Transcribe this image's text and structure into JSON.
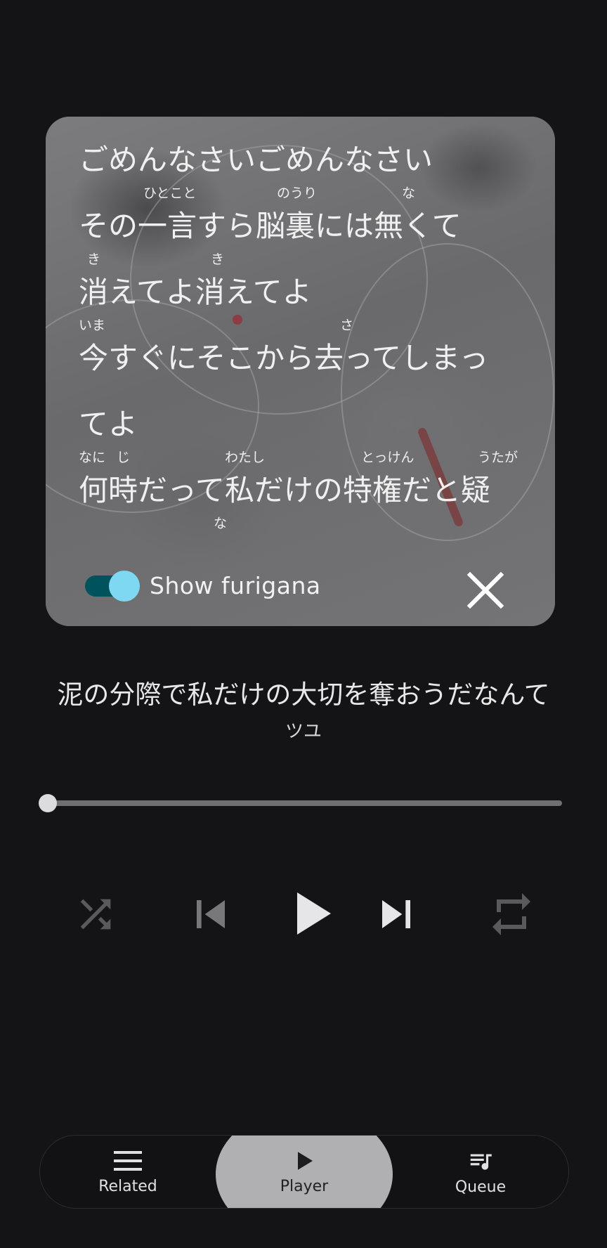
{
  "lyrics_card": {
    "lines": [
      {
        "text": "ごめんなさいごめんなさい",
        "ruby": []
      },
      {
        "text": "その一言すら脳裏には無くて",
        "ruby": [
          "ひとこと",
          "のうり",
          "な"
        ]
      },
      {
        "text": "消えてよ消えてよ",
        "ruby": [
          "き",
          "き"
        ]
      },
      {
        "text": "今すぐにそこから去ってしまっ",
        "ruby": [
          "いま",
          "さ"
        ]
      },
      {
        "text": "てよ",
        "ruby": []
      },
      {
        "text": "何時だって私だけの特権だと疑",
        "ruby": [
          "なに",
          "じ",
          "わたし",
          "とっけん",
          "うたが"
        ]
      },
      {
        "text": "",
        "ruby": [
          "な"
        ]
      }
    ],
    "furigana_toggle": {
      "label": "Show furigana",
      "on": true
    },
    "close_icon": "close-icon",
    "colors": {
      "toggle_track": "#00535c",
      "toggle_thumb": "#7fd8f2"
    }
  },
  "track": {
    "title": "泥の分際で私だけの大切を奪おうだなんて",
    "artist": "ツユ"
  },
  "progress": {
    "fraction": 0.0
  },
  "controls": {
    "shuffle": {
      "icon": "shuffle-icon",
      "enabled": false
    },
    "previous": {
      "icon": "skip-previous-icon",
      "enabled": false
    },
    "play": {
      "icon": "play-icon"
    },
    "next": {
      "icon": "skip-next-icon",
      "enabled": true
    },
    "repeat": {
      "icon": "repeat-icon",
      "enabled": false
    }
  },
  "bottom_nav": {
    "items": [
      {
        "label": "Related",
        "icon": "menu-icon",
        "active": false
      },
      {
        "label": "Player",
        "icon": "play-icon",
        "active": true
      },
      {
        "label": "Queue",
        "icon": "queue-music-icon",
        "active": false
      }
    ]
  }
}
